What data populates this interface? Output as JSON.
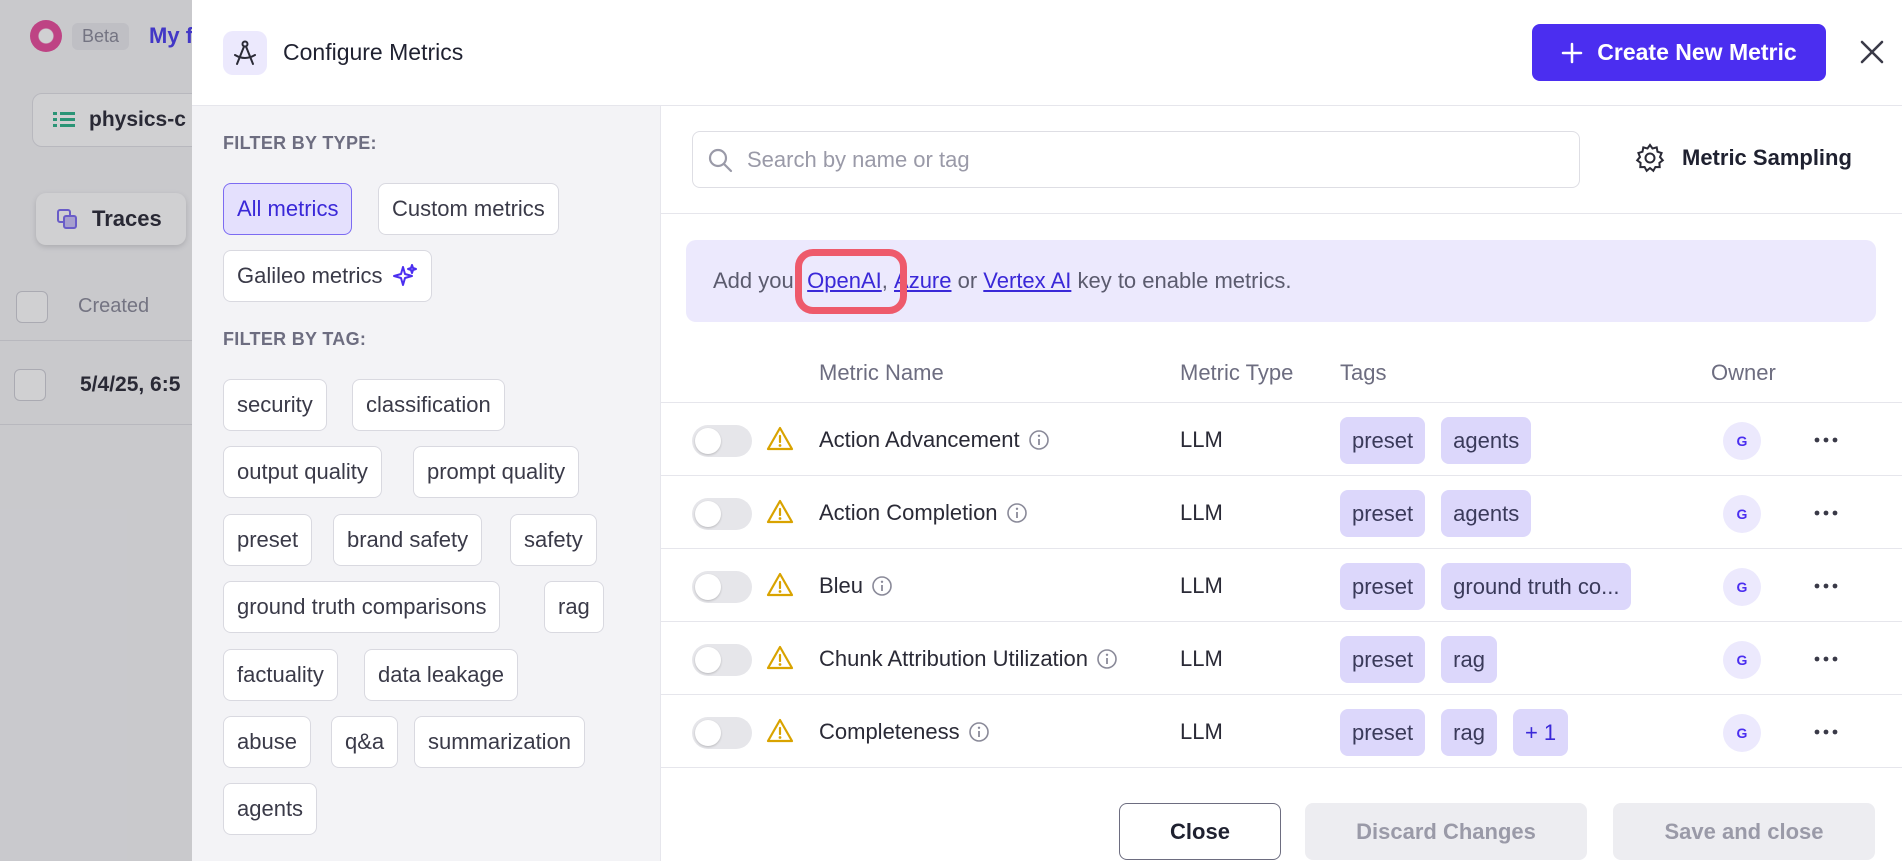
{
  "background": {
    "beta_label": "Beta",
    "project_name": "My fi",
    "project_pill": "physics-c",
    "traces_tab": "Traces",
    "col_created": "Created",
    "row_date": "5/4/25, 6:5"
  },
  "drawer": {
    "title": "Configure Metrics",
    "create_label": "Create New Metric"
  },
  "filters": {
    "type_label": "FILTER BY TYPE:",
    "types": [
      "All metrics",
      "Custom metrics",
      "Galileo metrics"
    ],
    "tag_label": "FILTER BY TAG:",
    "tags": [
      "security",
      "classification",
      "output quality",
      "prompt quality",
      "preset",
      "brand safety",
      "safety",
      "ground truth comparisons",
      "rag",
      "factuality",
      "data leakage",
      "abuse",
      "q&a",
      "summarization",
      "agents"
    ]
  },
  "search": {
    "placeholder": "Search by name or tag"
  },
  "sampling_label": "Metric Sampling",
  "banner": {
    "prefix": "Add your ",
    "link1": "OpenAI",
    "sep1": ", ",
    "link2": "Azure",
    "sep2": " or ",
    "link3": "Vertex AI",
    "suffix": " key to enable metrics."
  },
  "table": {
    "headers": [
      "Metric Name",
      "Metric Type",
      "Tags",
      "Owner"
    ],
    "rows": [
      {
        "name": "Action Advancement",
        "type": "LLM",
        "tags": [
          "preset",
          "agents"
        ],
        "owner": "G"
      },
      {
        "name": "Action Completion",
        "type": "LLM",
        "tags": [
          "preset",
          "agents"
        ],
        "owner": "G"
      },
      {
        "name": "Bleu",
        "type": "LLM",
        "tags": [
          "preset",
          "ground truth co..."
        ],
        "owner": "G"
      },
      {
        "name": "Chunk Attribution Utilization",
        "type": "LLM",
        "tags": [
          "preset",
          "rag"
        ],
        "owner": "G"
      },
      {
        "name": "Completeness",
        "type": "LLM",
        "tags": [
          "preset",
          "rag",
          "+ 1"
        ],
        "owner": "G"
      }
    ]
  },
  "footer": {
    "close": "Close",
    "discard": "Discard Changes",
    "save": "Save and close"
  },
  "colors": {
    "accent": "#4b2ef0",
    "highlight": "#ee5a6b",
    "tag_bg": "#dcd7fb",
    "warning": "#d9a300"
  }
}
